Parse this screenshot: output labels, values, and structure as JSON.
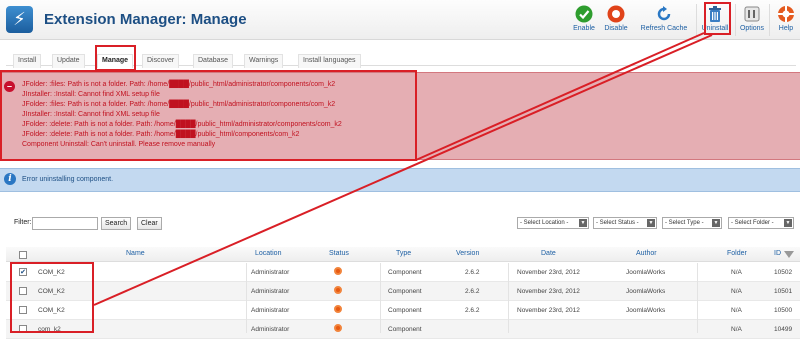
{
  "header": {
    "title": "Extension Manager: Manage",
    "toolbar": [
      {
        "label": "Enable",
        "icon": "check-icon"
      },
      {
        "label": "Disable",
        "icon": "stop-icon"
      },
      {
        "label": "Refresh Cache",
        "icon": "refresh-icon"
      },
      {
        "label": "Uninstall",
        "icon": "trash-icon"
      },
      {
        "label": "Options",
        "icon": "options-icon"
      },
      {
        "label": "Help",
        "icon": "help-icon"
      }
    ]
  },
  "tabs": [
    "Install",
    "Update",
    "Manage",
    "Discover",
    "Database",
    "Warnings",
    "Install languages"
  ],
  "active_tab": "Manage",
  "errors": [
    "JFolder: :files: Path is not a folder. Path: /home/████/public_html/administrator/components/com_k2",
    "JInstaller: :Install: Cannot find XML setup file",
    "JFolder: :files: Path is not a folder. Path: /home/████/public_html/administrator/components/com_k2",
    "JInstaller: :Install: Cannot find XML setup file",
    "JFolder: :delete: Path is not a folder. Path: /home/████/public_html/administrator/components/com_k2",
    "JFolder: :delete: Path is not a folder. Path: /home/████/public_html/components/com_k2",
    "Component Uninstall: Can't uninstall. Please remove manually"
  ],
  "info_message": "Error uninstalling component.",
  "filter": {
    "label": "Filter:",
    "value": "",
    "search_label": "Search",
    "clear_label": "Clear",
    "selects": [
      "- Select Location -",
      "- Select Status -",
      "- Select Type -",
      "- Select Folder -"
    ]
  },
  "table": {
    "columns": [
      "Name",
      "Location",
      "Status",
      "Type",
      "Version",
      "Date",
      "Author",
      "Folder",
      "ID"
    ],
    "rows": [
      {
        "checked": true,
        "name": "COM_K2",
        "location": "Administrator",
        "type": "Component",
        "version": "2.6.2",
        "date": "November 23rd, 2012",
        "author": "JoomlaWorks",
        "folder": "N/A",
        "id": "10502"
      },
      {
        "checked": false,
        "name": "COM_K2",
        "location": "Administrator",
        "type": "Component",
        "version": "2.6.2",
        "date": "November 23rd, 2012",
        "author": "JoomlaWorks",
        "folder": "N/A",
        "id": "10501"
      },
      {
        "checked": false,
        "name": "COM_K2",
        "location": "Administrator",
        "type": "Component",
        "version": "2.6.2",
        "date": "November 23rd, 2012",
        "author": "JoomlaWorks",
        "folder": "N/A",
        "id": "10500"
      },
      {
        "checked": false,
        "name": "com_k2",
        "location": "Administrator",
        "type": "Component",
        "version": "",
        "date": "",
        "author": "",
        "folder": "N/A",
        "id": "10499"
      }
    ]
  },
  "colors": {
    "annotation": "#d91f26",
    "error_text": "#c0111f",
    "error_bg": "#e5aeb3",
    "info_bg": "#c3d9f0",
    "title": "#1d4f84"
  }
}
